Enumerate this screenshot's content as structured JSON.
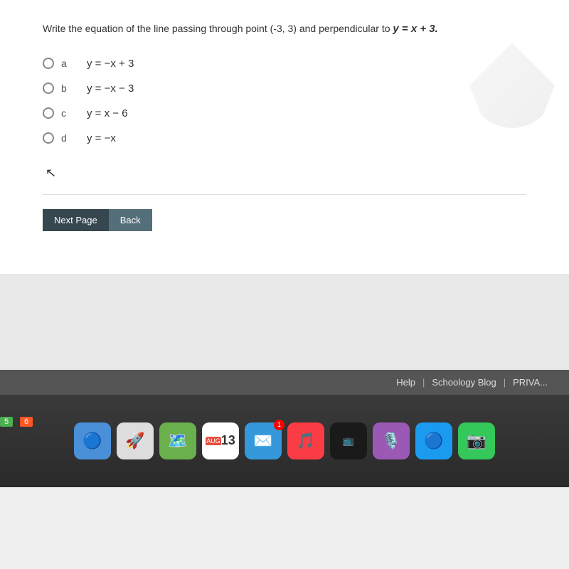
{
  "question": {
    "text": "Write the equation of the line passing through point (-3, 3) and perpendicular to ",
    "formula": "y = x + 3",
    "full_text": "Write the equation of the line passing through point (-3, 3) and perpendicular to y = x + 3."
  },
  "options": [
    {
      "id": "a",
      "label": "a",
      "formula": "y = −x + 3"
    },
    {
      "id": "b",
      "label": "b",
      "formula": "y = −x − 3"
    },
    {
      "id": "c",
      "label": "c",
      "formula": "y = x − 6"
    },
    {
      "id": "d",
      "label": "d",
      "formula": "y = −x"
    }
  ],
  "buttons": {
    "next_page": "Next Page",
    "back": "Back"
  },
  "footer": {
    "help": "Help",
    "blog": "Schoology Blog",
    "privacy": "PRIVA..."
  },
  "taskbar": {
    "date": "13",
    "month": "AUG",
    "badge_count": "1",
    "corner_num_1": "5",
    "corner_num_2": "6"
  }
}
